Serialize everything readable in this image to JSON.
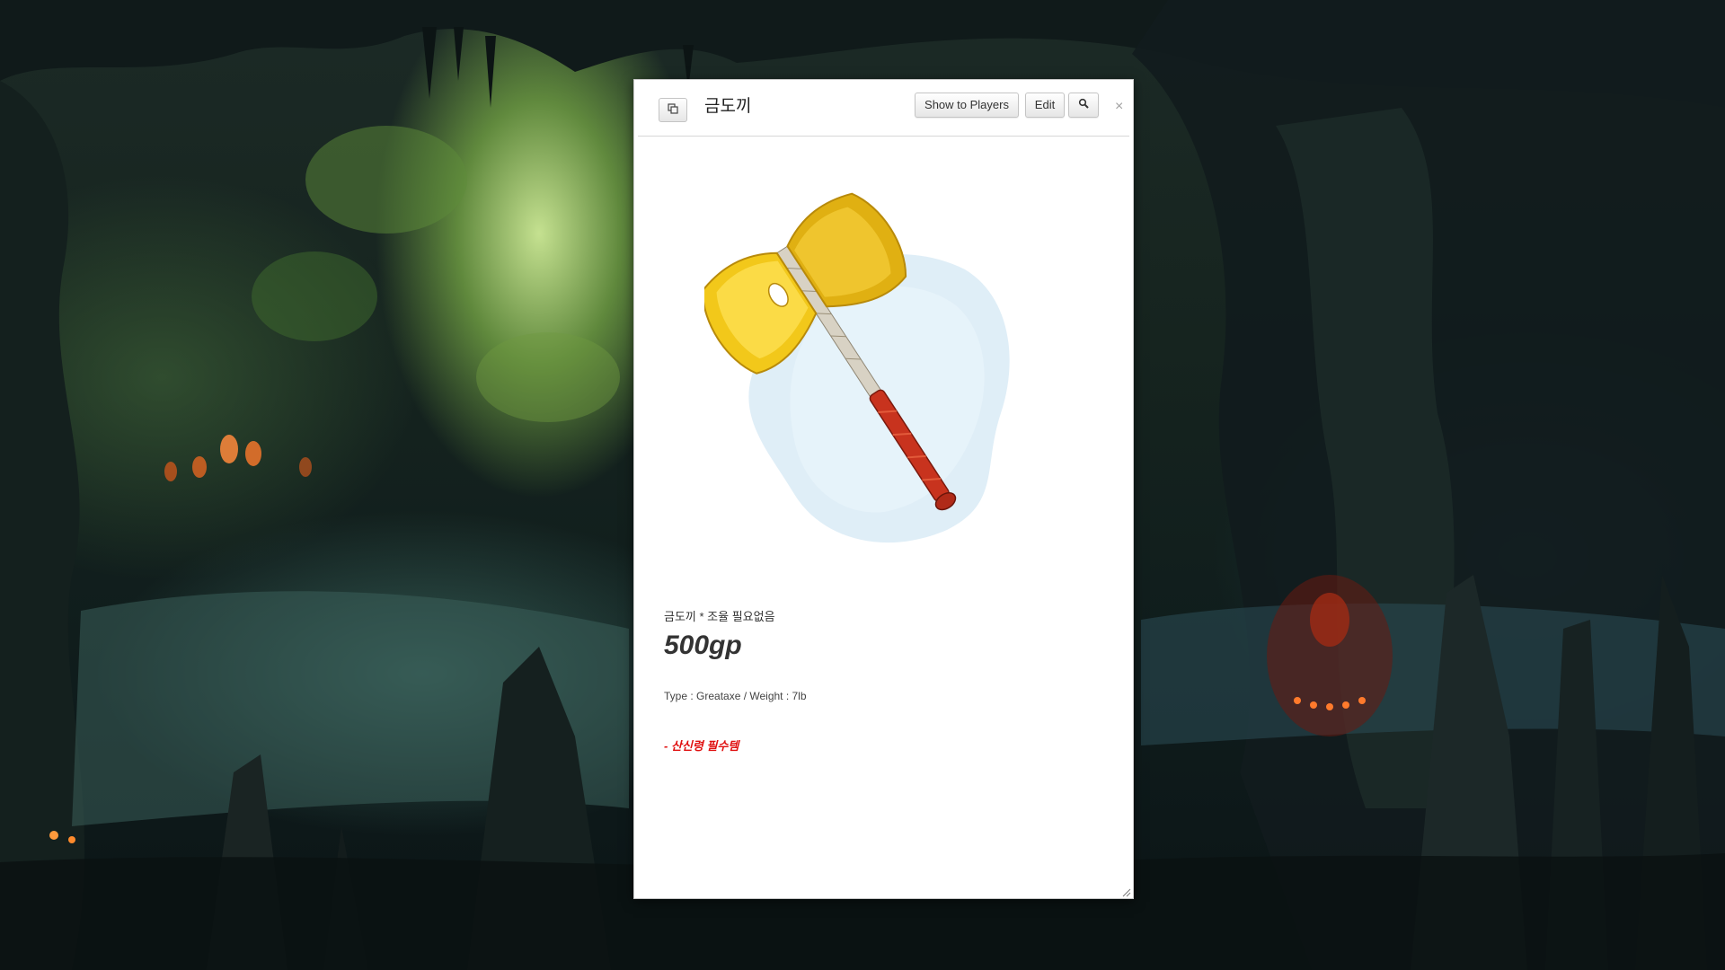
{
  "dialog": {
    "title": "금도끼",
    "buttons": {
      "popout_icon": "popout-icon",
      "show_to_players": "Show to Players",
      "edit": "Edit",
      "search_icon": "search-icon",
      "close": "×"
    }
  },
  "item": {
    "image_icon": "golden-greataxe",
    "subtitle": "금도끼 * 조율 필요없음",
    "price": "500gp",
    "stats": "Type : Greataxe / Weight : 7lb",
    "note": "- 산신령 필수템"
  },
  "colors": {
    "note_red": "#e01010",
    "axe_gold": "#f2c81a",
    "handle_red": "#c8331e"
  }
}
